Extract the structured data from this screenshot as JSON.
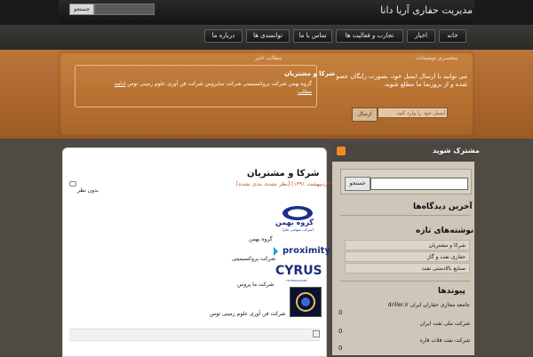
{
  "header": {
    "site_title": "مدیریت حفاری آریا دانا",
    "search_button": "جستجو"
  },
  "nav": [
    {
      "label": "خانه"
    },
    {
      "label": "اخبار"
    },
    {
      "label": "تجارب و فعالیت ها"
    },
    {
      "label": "تماس با ما"
    },
    {
      "label": "توانمندی ها"
    },
    {
      "label": "درباره ما"
    }
  ],
  "featured": {
    "title": "مختصری توضیحات",
    "text": "می توانید با ارسال ایمیل خود، بصورت رایگان عضو شده و از بروزنما ما مطلع شوید.",
    "email_placeholder": "ایمیل خود را وارد کنید",
    "send_button": "ارسال"
  },
  "recent": {
    "title": "مطالب اخیر",
    "heading": "شرکا و مشتریان",
    "body": "گروه بهمن شرکت پروکسیمیتی شرکت سایروس شرکت فن آوری علوم زمینی توس",
    "read_more": "ادامه مطلب"
  },
  "post": {
    "title": "شرکا و مشتریان",
    "meta": "[تاریخ ۹ اردیبهشت ۱۳۹۱] [نظر نشده، بندی نشده]",
    "no_comment": "بدون نظر",
    "logo_bahman": "گروه بهمن",
    "logo_bahman_sub": "(شرکت سهامی عام)",
    "logo_proximity": "proximity",
    "logo_cyrus": "CYRUS",
    "logo_cyrus_sub": "TECHNOLOGIES",
    "captions": [
      "گروه بهمن",
      "شرکت پروکسیمیتی",
      "شرکت ما پروس",
      "شرکت فن آوری علوم زمینی توس"
    ]
  },
  "sidebar": {
    "subscribe_title": "مشترک شوید",
    "search_button": "جستجو",
    "latest_comments_title": "آخرین دیدگاه‌ها",
    "new_posts_title": "نوشته‌های تازه",
    "new_posts": [
      "شرکا و مشتریان",
      "حفاری نفت و گاز",
      "صنایع بالادستی نفت"
    ],
    "links_title": "پیوندها",
    "links": [
      {
        "label": "جامعه مجازی حفاران ایران driller.ir",
        "count": "0"
      },
      {
        "label": "شرکت ملی نفت ایران",
        "count": "0"
      },
      {
        "label": "شرکت نفت فلات قاره",
        "count": "0"
      }
    ]
  },
  "colors": {
    "accent_orange": "#b06a2e",
    "dark": "#1a1a1a",
    "sidebar_bg": "#cfc6b9"
  }
}
